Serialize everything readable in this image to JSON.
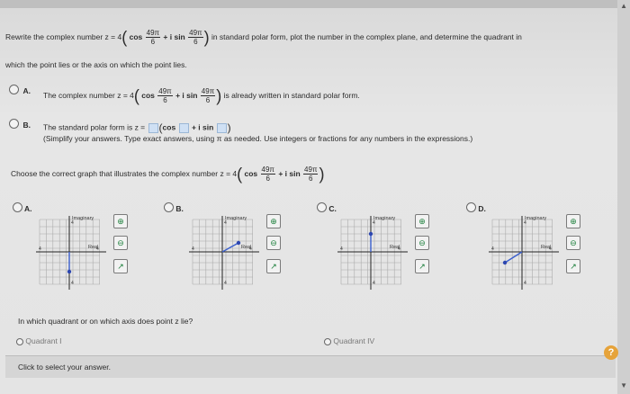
{
  "question": {
    "prefix": "Rewrite the complex number z = 4",
    "cos": "cos",
    "plus_i_sin": "+ i sin",
    "frac_num": "49π",
    "frac_den": "6",
    "suffix": "in standard polar form, plot the number in the complex plane, and determine the quadrant in",
    "line2": "which the point lies or the axis on which the point lies."
  },
  "option_a": {
    "letter": "A.",
    "prefix": "The complex number z = 4",
    "suffix": "is already written in standard polar form."
  },
  "option_b": {
    "letter": "B.",
    "prefix": "The standard polar form is z =",
    "cos": "cos",
    "plus_i_sin": "+ i sin",
    "note": "(Simplify your answers. Type exact answers, using π as needed. Use integers or fractions for any numbers in the expressions.)"
  },
  "graph_question": {
    "prefix": "Choose the correct graph that illustrates the complex number z = 4"
  },
  "graph_options": [
    {
      "letter": "A.",
      "imaginary": "Imaginary",
      "real": "Real",
      "labels": [
        "4",
        "4",
        "4",
        "4"
      ]
    },
    {
      "letter": "B.",
      "imaginary": "Imaginary",
      "real": "Real",
      "labels": [
        "4",
        "4",
        "4",
        "4"
      ]
    },
    {
      "letter": "C.",
      "imaginary": "Imaginary",
      "real": "Real",
      "labels": [
        "4",
        "4",
        "4",
        "4"
      ]
    },
    {
      "letter": "D.",
      "imaginary": "Imaginary",
      "real": "Real",
      "labels": [
        "4",
        "4",
        "4",
        "4"
      ]
    }
  ],
  "quadrant_question": "In which quadrant or on which axis does point z lie?",
  "quadrant_options": {
    "a": "Quadrant I",
    "b": "Quadrant IV"
  },
  "answer_prompt": "Click to select your answer.",
  "help_label": "?"
}
